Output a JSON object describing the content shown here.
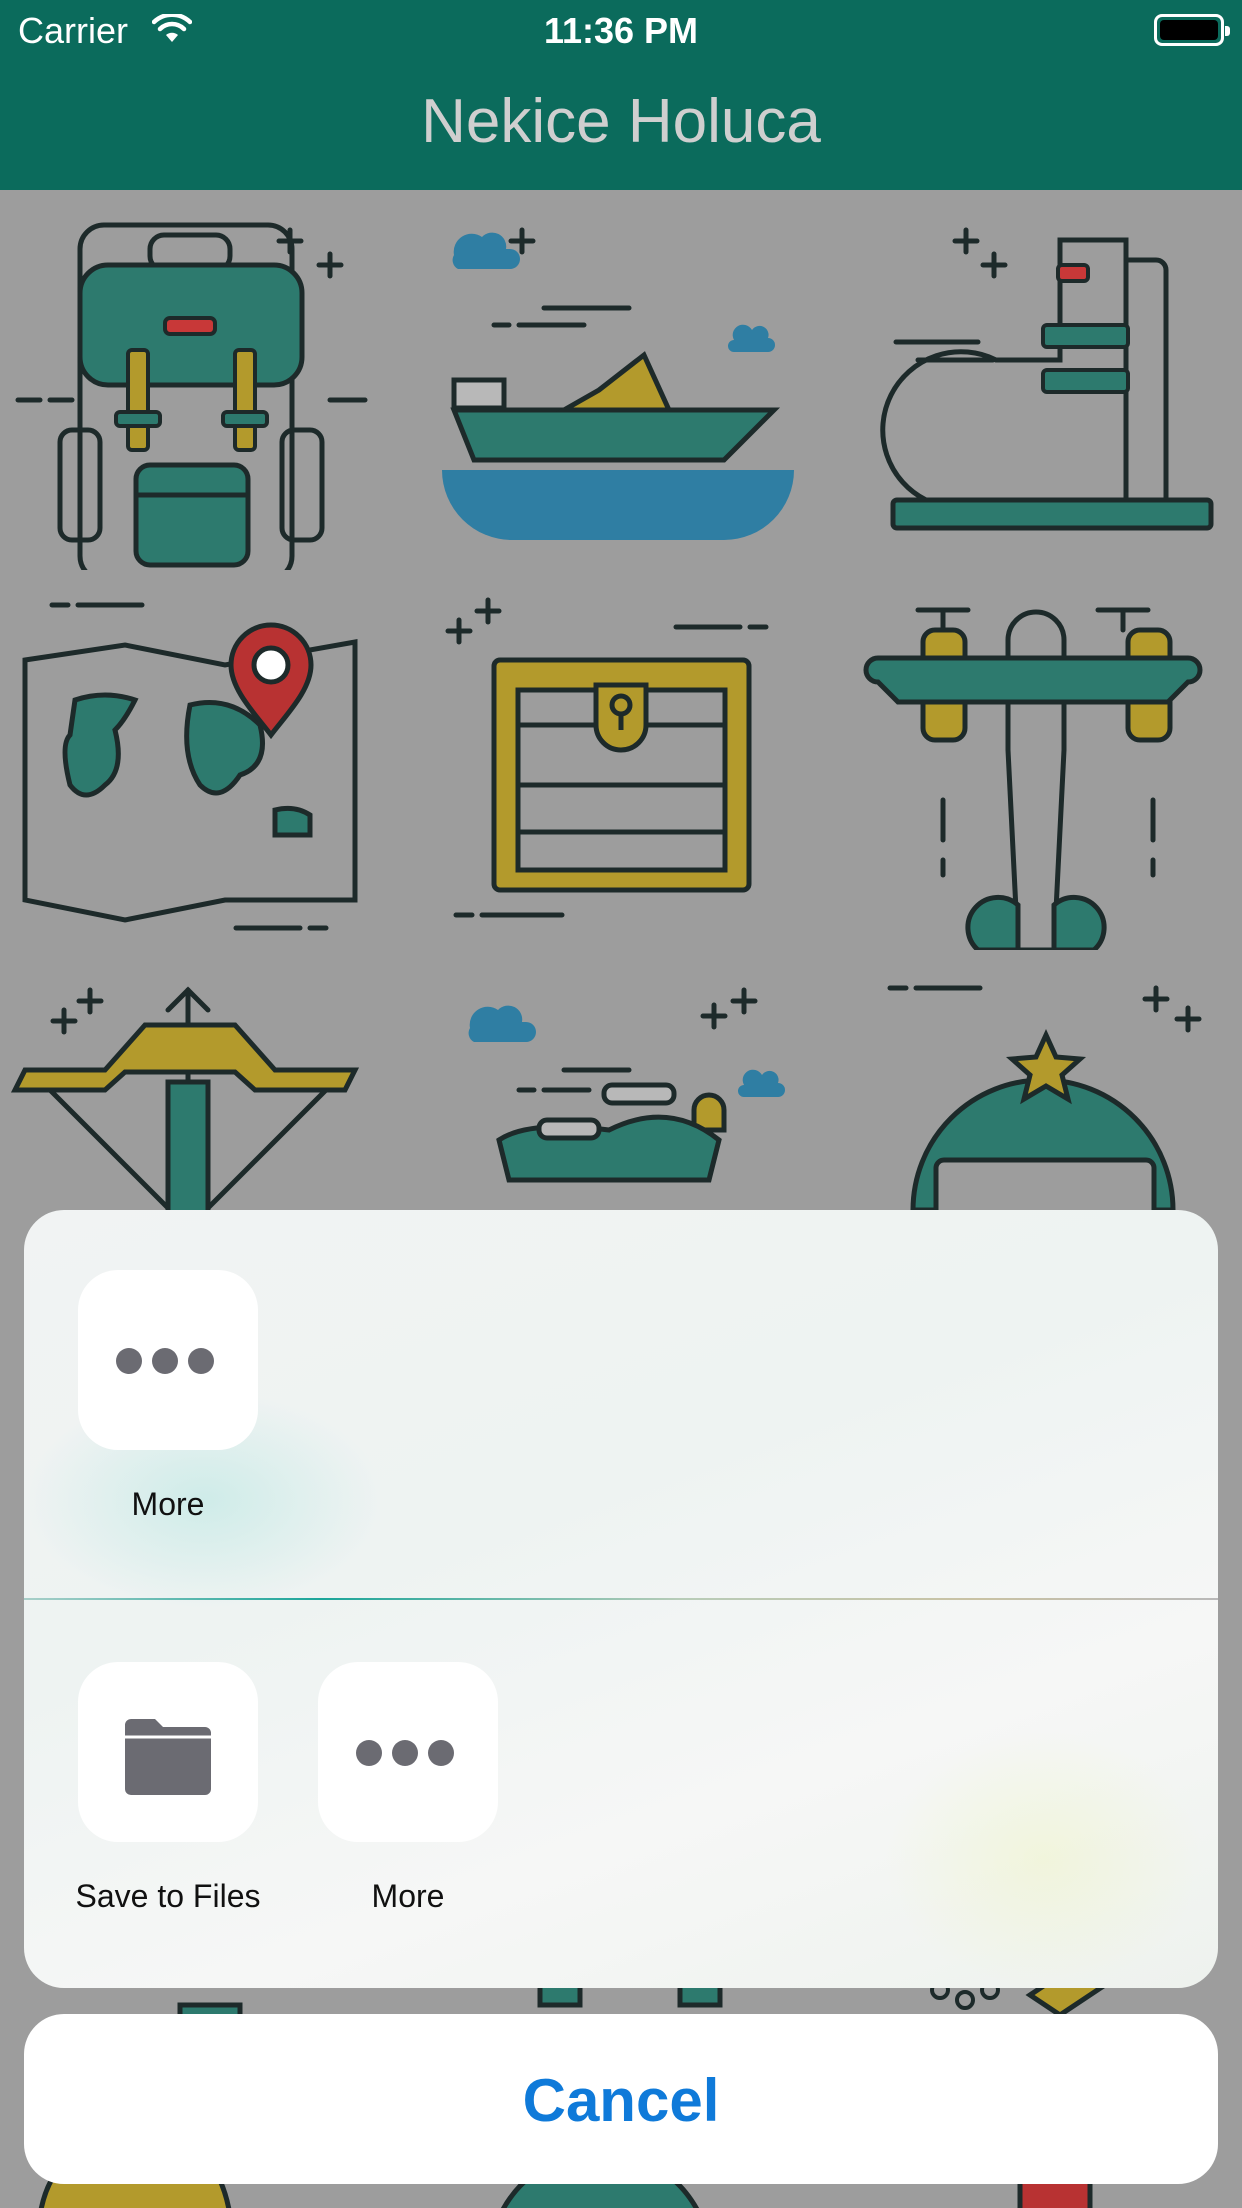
{
  "status_bar": {
    "carrier": "Carrier",
    "time": "11:36 PM"
  },
  "nav": {
    "title": "Nekice Holuca"
  },
  "colors": {
    "teal": "#0b6b5c",
    "mustard": "#a88f2a",
    "red": "#b83232",
    "blue": "#2f7ea3",
    "cancel_blue": "#0f7ad9"
  },
  "background_icons": [
    "backpack-icon",
    "speedboat-icon",
    "boot-icon",
    "map-pin-icon",
    "treasure-chest-icon",
    "airplane-icon",
    "crossbow-icon",
    "motorbike-icon",
    "helmet-icon"
  ],
  "share_sheet": {
    "row1": [
      {
        "label": "More",
        "icon": "more-dots-icon"
      }
    ],
    "row2": [
      {
        "label": "Save to Files",
        "icon": "folder-icon"
      },
      {
        "label": "More",
        "icon": "more-dots-icon"
      }
    ],
    "cancel_label": "Cancel"
  }
}
